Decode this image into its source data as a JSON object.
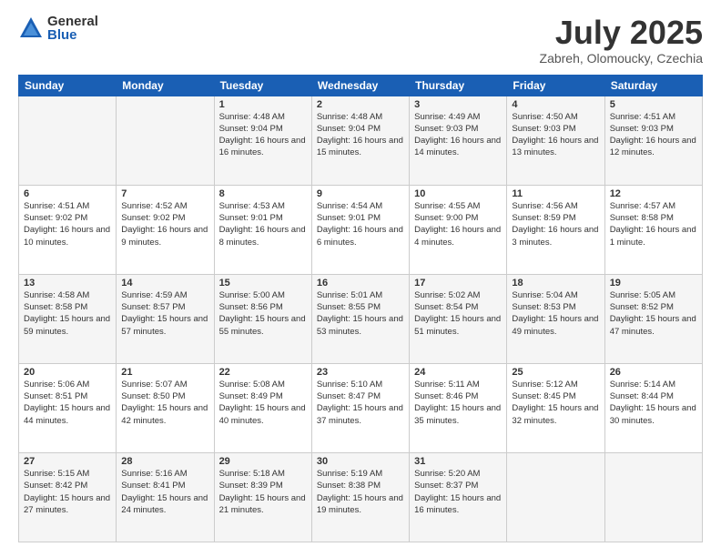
{
  "logo": {
    "general": "General",
    "blue": "Blue"
  },
  "header": {
    "title": "July 2025",
    "subtitle": "Zabreh, Olomoucky, Czechia"
  },
  "days_of_week": [
    "Sunday",
    "Monday",
    "Tuesday",
    "Wednesday",
    "Thursday",
    "Friday",
    "Saturday"
  ],
  "weeks": [
    [
      {
        "day": "",
        "info": ""
      },
      {
        "day": "",
        "info": ""
      },
      {
        "day": "1",
        "info": "Sunrise: 4:48 AM\nSunset: 9:04 PM\nDaylight: 16 hours and 16 minutes."
      },
      {
        "day": "2",
        "info": "Sunrise: 4:48 AM\nSunset: 9:04 PM\nDaylight: 16 hours and 15 minutes."
      },
      {
        "day": "3",
        "info": "Sunrise: 4:49 AM\nSunset: 9:03 PM\nDaylight: 16 hours and 14 minutes."
      },
      {
        "day": "4",
        "info": "Sunrise: 4:50 AM\nSunset: 9:03 PM\nDaylight: 16 hours and 13 minutes."
      },
      {
        "day": "5",
        "info": "Sunrise: 4:51 AM\nSunset: 9:03 PM\nDaylight: 16 hours and 12 minutes."
      }
    ],
    [
      {
        "day": "6",
        "info": "Sunrise: 4:51 AM\nSunset: 9:02 PM\nDaylight: 16 hours and 10 minutes."
      },
      {
        "day": "7",
        "info": "Sunrise: 4:52 AM\nSunset: 9:02 PM\nDaylight: 16 hours and 9 minutes."
      },
      {
        "day": "8",
        "info": "Sunrise: 4:53 AM\nSunset: 9:01 PM\nDaylight: 16 hours and 8 minutes."
      },
      {
        "day": "9",
        "info": "Sunrise: 4:54 AM\nSunset: 9:01 PM\nDaylight: 16 hours and 6 minutes."
      },
      {
        "day": "10",
        "info": "Sunrise: 4:55 AM\nSunset: 9:00 PM\nDaylight: 16 hours and 4 minutes."
      },
      {
        "day": "11",
        "info": "Sunrise: 4:56 AM\nSunset: 8:59 PM\nDaylight: 16 hours and 3 minutes."
      },
      {
        "day": "12",
        "info": "Sunrise: 4:57 AM\nSunset: 8:58 PM\nDaylight: 16 hours and 1 minute."
      }
    ],
    [
      {
        "day": "13",
        "info": "Sunrise: 4:58 AM\nSunset: 8:58 PM\nDaylight: 15 hours and 59 minutes."
      },
      {
        "day": "14",
        "info": "Sunrise: 4:59 AM\nSunset: 8:57 PM\nDaylight: 15 hours and 57 minutes."
      },
      {
        "day": "15",
        "info": "Sunrise: 5:00 AM\nSunset: 8:56 PM\nDaylight: 15 hours and 55 minutes."
      },
      {
        "day": "16",
        "info": "Sunrise: 5:01 AM\nSunset: 8:55 PM\nDaylight: 15 hours and 53 minutes."
      },
      {
        "day": "17",
        "info": "Sunrise: 5:02 AM\nSunset: 8:54 PM\nDaylight: 15 hours and 51 minutes."
      },
      {
        "day": "18",
        "info": "Sunrise: 5:04 AM\nSunset: 8:53 PM\nDaylight: 15 hours and 49 minutes."
      },
      {
        "day": "19",
        "info": "Sunrise: 5:05 AM\nSunset: 8:52 PM\nDaylight: 15 hours and 47 minutes."
      }
    ],
    [
      {
        "day": "20",
        "info": "Sunrise: 5:06 AM\nSunset: 8:51 PM\nDaylight: 15 hours and 44 minutes."
      },
      {
        "day": "21",
        "info": "Sunrise: 5:07 AM\nSunset: 8:50 PM\nDaylight: 15 hours and 42 minutes."
      },
      {
        "day": "22",
        "info": "Sunrise: 5:08 AM\nSunset: 8:49 PM\nDaylight: 15 hours and 40 minutes."
      },
      {
        "day": "23",
        "info": "Sunrise: 5:10 AM\nSunset: 8:47 PM\nDaylight: 15 hours and 37 minutes."
      },
      {
        "day": "24",
        "info": "Sunrise: 5:11 AM\nSunset: 8:46 PM\nDaylight: 15 hours and 35 minutes."
      },
      {
        "day": "25",
        "info": "Sunrise: 5:12 AM\nSunset: 8:45 PM\nDaylight: 15 hours and 32 minutes."
      },
      {
        "day": "26",
        "info": "Sunrise: 5:14 AM\nSunset: 8:44 PM\nDaylight: 15 hours and 30 minutes."
      }
    ],
    [
      {
        "day": "27",
        "info": "Sunrise: 5:15 AM\nSunset: 8:42 PM\nDaylight: 15 hours and 27 minutes."
      },
      {
        "day": "28",
        "info": "Sunrise: 5:16 AM\nSunset: 8:41 PM\nDaylight: 15 hours and 24 minutes."
      },
      {
        "day": "29",
        "info": "Sunrise: 5:18 AM\nSunset: 8:39 PM\nDaylight: 15 hours and 21 minutes."
      },
      {
        "day": "30",
        "info": "Sunrise: 5:19 AM\nSunset: 8:38 PM\nDaylight: 15 hours and 19 minutes."
      },
      {
        "day": "31",
        "info": "Sunrise: 5:20 AM\nSunset: 8:37 PM\nDaylight: 15 hours and 16 minutes."
      },
      {
        "day": "",
        "info": ""
      },
      {
        "day": "",
        "info": ""
      }
    ]
  ]
}
